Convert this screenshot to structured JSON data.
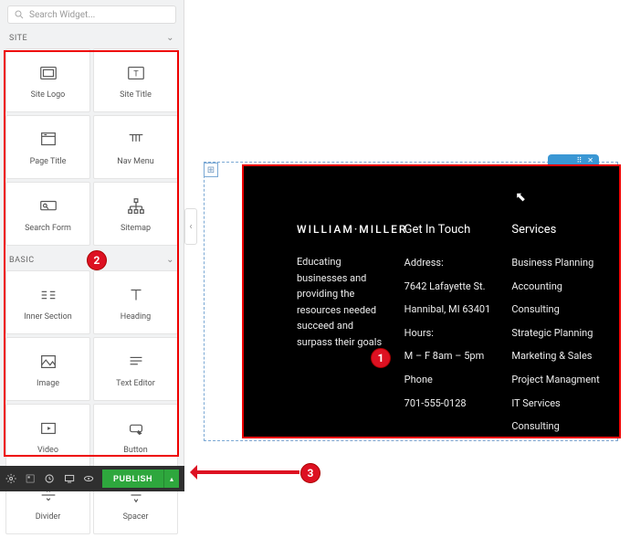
{
  "search": {
    "placeholder": "Search Widget..."
  },
  "categories": {
    "site": {
      "label": "SITE"
    },
    "basic": {
      "label": "BASIC"
    }
  },
  "widgets_site": [
    {
      "name": "Site Logo"
    },
    {
      "name": "Site Title"
    },
    {
      "name": "Page Title"
    },
    {
      "name": "Nav Menu"
    },
    {
      "name": "Search Form"
    },
    {
      "name": "Sitemap"
    }
  ],
  "widgets_basic": [
    {
      "name": "Inner Section"
    },
    {
      "name": "Heading"
    },
    {
      "name": "Image"
    },
    {
      "name": "Text Editor"
    },
    {
      "name": "Video"
    },
    {
      "name": "Button"
    },
    {
      "name": "Divider"
    },
    {
      "name": "Spacer"
    }
  ],
  "publish": {
    "label": "PUBLISH"
  },
  "footer": {
    "brand": "WILLIAM·MILLER",
    "tagline1": "Educating businesses and providing the resources needed succeed and surpass their goals",
    "touch_title": "Get In Touch",
    "address_label": "Address:",
    "address_line1": "7642 Lafayette St.",
    "address_line2": "Hannibal, MI 63401",
    "hours_label": "Hours:",
    "hours_value": "M – F 8am – 5pm",
    "phone_label": "Phone",
    "phone_value": "701-555-0128",
    "services_title": "Services",
    "services": [
      "Business Planning",
      "Accounting",
      "Consulting",
      "Strategic Planning",
      "Marketing & Sales",
      "Project Managment",
      "IT Services",
      "Consulting"
    ]
  },
  "annotations": {
    "b1": "1",
    "b2": "2",
    "b3": "3"
  }
}
